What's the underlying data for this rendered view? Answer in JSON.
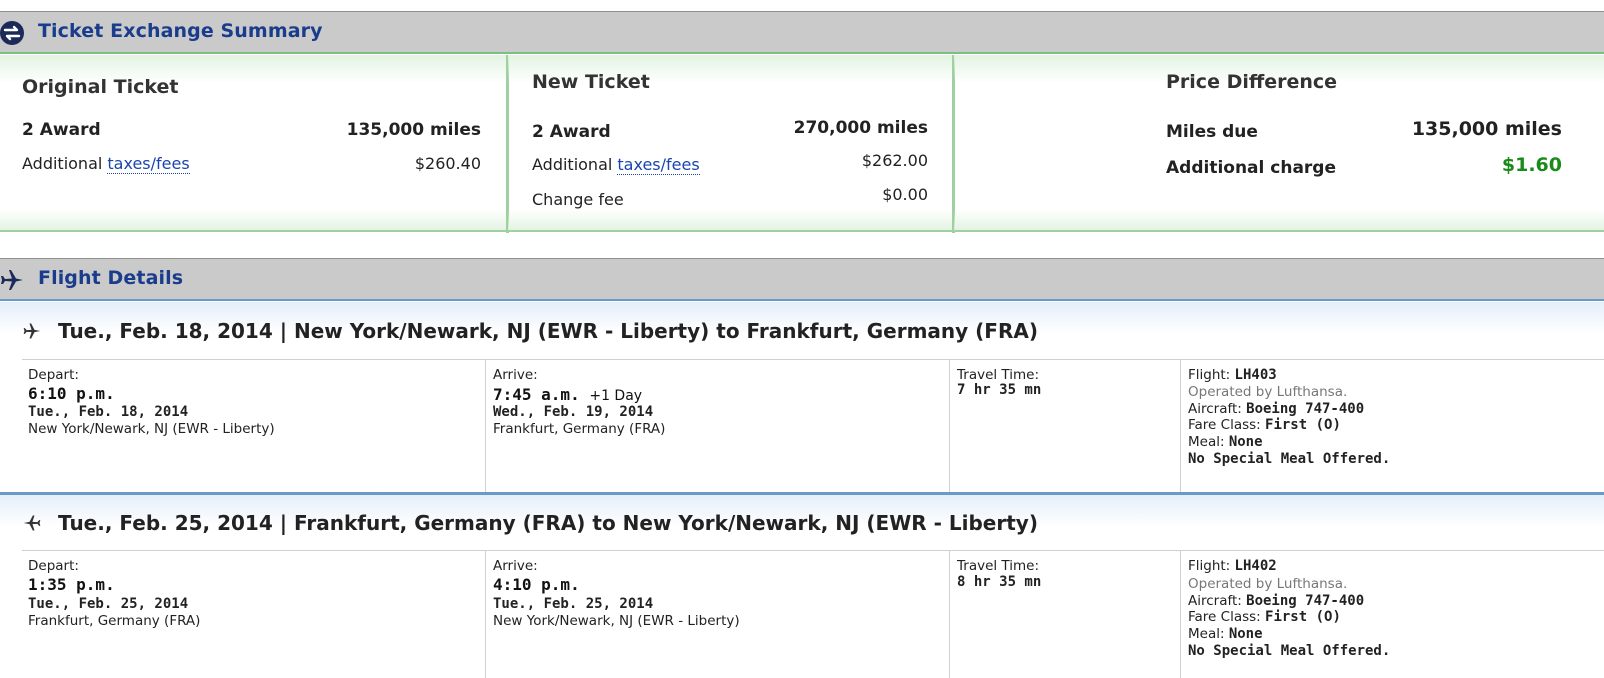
{
  "exchange_summary": {
    "title": "Ticket Exchange Summary",
    "icon": "exchange-icon",
    "original": {
      "heading": "Original Ticket",
      "award_label": "2 Award",
      "award_value": "135,000 miles",
      "taxes_prefix": "Additional ",
      "taxes_link": "taxes/fees",
      "taxes_value": "$260.40"
    },
    "new": {
      "heading": "New Ticket",
      "award_label": "2 Award",
      "award_value": "270,000 miles",
      "taxes_prefix": "Additional ",
      "taxes_link": "taxes/fees",
      "taxes_value": "$262.00",
      "change_fee_label": "Change fee",
      "change_fee_value": "$0.00"
    },
    "difference": {
      "heading": "Price Difference",
      "miles_label": "Miles due",
      "miles_value": "135,000 miles",
      "charge_label": "Additional charge",
      "charge_value": "$1.60",
      "charge_color": "#1a8a1a"
    }
  },
  "flight_details": {
    "title": "Flight Details",
    "icon": "airplane-icon",
    "accent": "#1a3c8c",
    "flights": [
      {
        "title": "Tue., Feb. 18, 2014 | New York/Newark, NJ (EWR - Liberty) to Frankfurt, Germany (FRA)",
        "depart_label": "Depart:",
        "depart_time": "6:10 p.m.",
        "depart_date": "Tue., Feb. 18, 2014",
        "depart_city": "New York/Newark, NJ (EWR - Liberty)",
        "arrive_label": "Arrive:",
        "arrive_time": "7:45 a.m.",
        "arrive_extra": "+1 Day",
        "arrive_date": "Wed., Feb. 19, 2014",
        "arrive_city": "Frankfurt, Germany (FRA)",
        "travel_label": "Travel Time:",
        "travel_time": "7 hr 35 mn",
        "flight_label": "Flight: ",
        "flight_no": "LH403",
        "operated": "Operated by Lufthansa.",
        "aircraft_label": "Aircraft: ",
        "aircraft": "Boeing 747-400",
        "fare_label": "Fare Class: ",
        "fare": "First (O)",
        "meal_label": "Meal: ",
        "meal": "None",
        "special_meal": "No Special Meal Offered."
      },
      {
        "title": "Tue., Feb. 25, 2014 | Frankfurt, Germany (FRA) to New York/Newark, NJ (EWR - Liberty)",
        "depart_label": "Depart:",
        "depart_time": "1:35 p.m.",
        "depart_date": "Tue., Feb. 25, 2014",
        "depart_city": "Frankfurt, Germany (FRA)",
        "arrive_label": "Arrive:",
        "arrive_time": "4:10 p.m.",
        "arrive_extra": "",
        "arrive_date": "Tue., Feb. 25, 2014",
        "arrive_city": "New York/Newark, NJ (EWR - Liberty)",
        "travel_label": "Travel Time:",
        "travel_time": "8 hr 35 mn",
        "flight_label": "Flight: ",
        "flight_no": "LH402",
        "operated": "Operated by Lufthansa.",
        "aircraft_label": "Aircraft: ",
        "aircraft": "Boeing 747-400",
        "fare_label": "Fare Class: ",
        "fare": "First (O)",
        "meal_label": "Meal: ",
        "meal": "None",
        "special_meal": "No Special Meal Offered."
      }
    ]
  }
}
